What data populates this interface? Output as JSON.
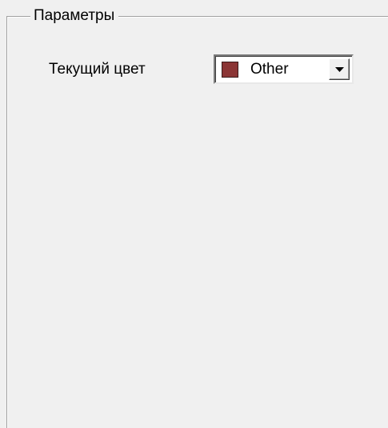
{
  "group": {
    "title": "Параметры"
  },
  "current_color": {
    "label": "Текущий цвет",
    "value": "Other",
    "swatch_color": "#8b3535",
    "dropdown_icon": "chevron-down-icon"
  }
}
